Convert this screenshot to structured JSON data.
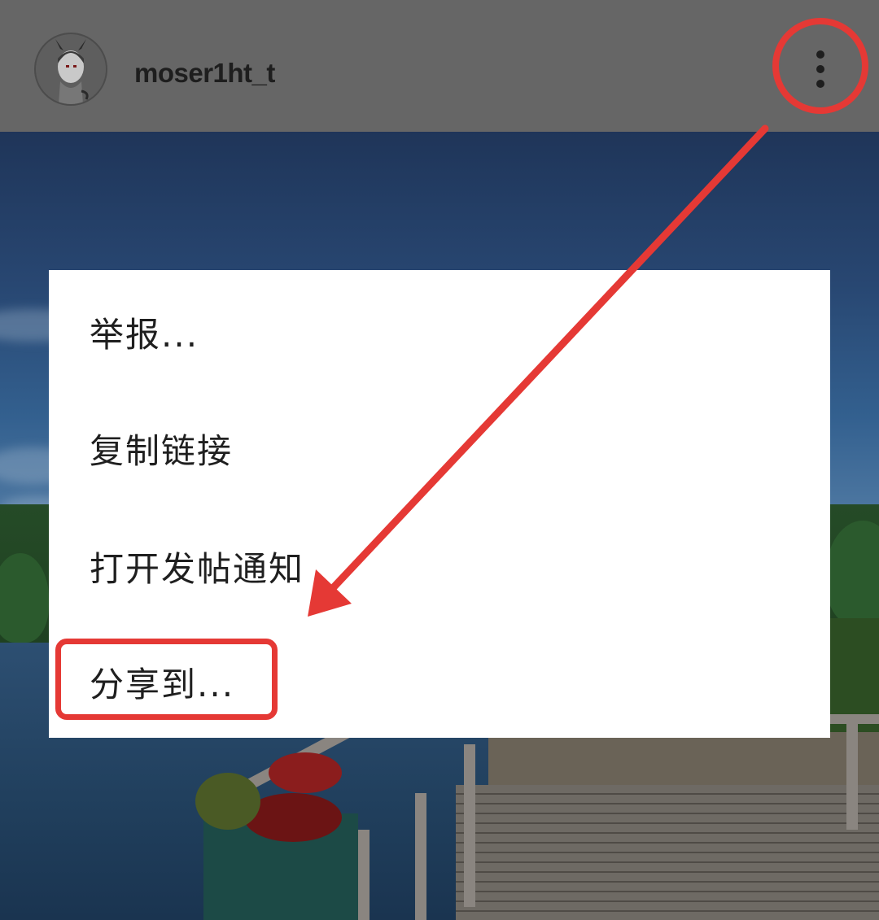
{
  "header": {
    "username": "moser1ht_t",
    "avatar_icon": "devil-avatar-icon",
    "more_icon": "vertical-ellipsis-icon"
  },
  "menu": {
    "items": [
      {
        "label": "举报..."
      },
      {
        "label": "复制链接"
      },
      {
        "label": "打开发帖通知"
      },
      {
        "label": "分享到..."
      }
    ]
  },
  "annotation": {
    "color": "#e53935",
    "highlighted_item": "分享到..."
  },
  "colors": {
    "header_bg": "#666666",
    "menu_bg": "#ffffff",
    "text": "#1f1f1f"
  }
}
